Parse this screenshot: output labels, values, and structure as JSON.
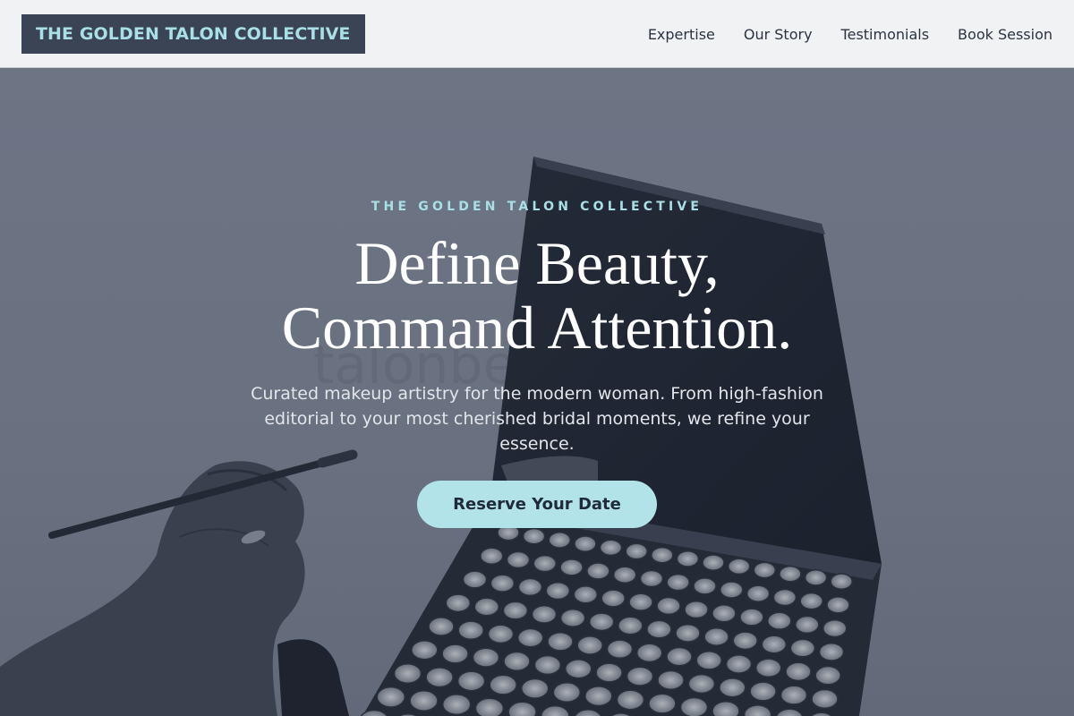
{
  "header": {
    "brand": "THE GOLDEN TALON COLLECTIVE",
    "nav": [
      {
        "label": "Expertise"
      },
      {
        "label": "Our Story"
      },
      {
        "label": "Testimonials"
      },
      {
        "label": "Book Session"
      }
    ]
  },
  "hero": {
    "eyebrow": "THE GOLDEN TALON COLLECTIVE",
    "headline_line1": "Define Beauty,",
    "headline_line2": "Command Attention.",
    "subcopy": "Curated makeup artistry for the modern woman. From high-fashion editorial to your most cherished bridal moments, we refine your essence.",
    "cta_label": "Reserve Your Date",
    "background_watermark": "talonbeauty"
  },
  "colors": {
    "brand_bg": "#3a4454",
    "brand_text": "#a9dfe6",
    "accent": "#b2e3e8",
    "header_bg": "#f1f2f4",
    "hero_bg": "#6f7686"
  }
}
